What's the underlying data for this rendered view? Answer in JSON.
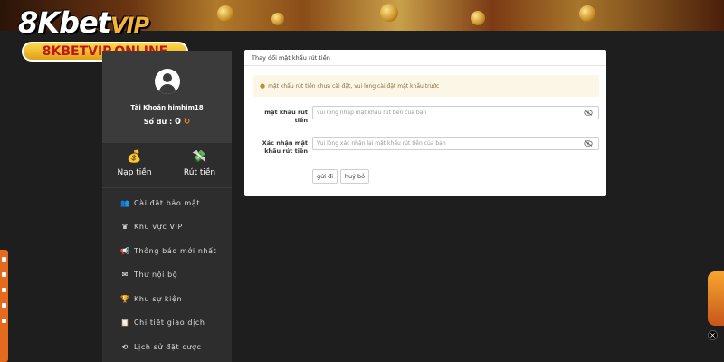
{
  "brand": {
    "logo_main": "8Kbet",
    "logo_vip": "VIP",
    "domain_pill": "8KBETVIP.ONLINE"
  },
  "profile": {
    "username": "Tài Khoản himhim18",
    "balance_label": "Số dư :",
    "balance_value": "0",
    "refresh_icon": "↻"
  },
  "actions": [
    {
      "label": "Nạp tiền",
      "icon": "deposit-icon",
      "glyph": "💰"
    },
    {
      "label": "Rút tiền",
      "icon": "withdraw-icon",
      "glyph": "💸"
    }
  ],
  "menu": [
    {
      "label": "Cài đặt bảo mật",
      "icon": "user-lock-icon",
      "glyph": "👥"
    },
    {
      "label": "Khu vực VIP",
      "icon": "crown-icon",
      "glyph": "♛"
    },
    {
      "label": "Thông báo mới nhất",
      "icon": "megaphone-icon",
      "glyph": "📢"
    },
    {
      "label": "Thư nội bộ",
      "icon": "envelope-icon",
      "glyph": "✉"
    },
    {
      "label": "Khu sự kiện",
      "icon": "trophy-icon",
      "glyph": "🏆"
    },
    {
      "label": "Chi tiết giao dịch",
      "icon": "clipboard-icon",
      "glyph": "📋"
    },
    {
      "label": "Lịch sử đặt cược",
      "icon": "history-icon",
      "glyph": "⟲"
    }
  ],
  "panel": {
    "title": "Thay đổi mật khẩu rút tiền",
    "alert_icon": "!",
    "alert_text": "mật khẩu rút tiền chưa cài đặt, vui lòng cài đặt mật khẩu trước",
    "field1_label": "mật khẩu rút tiền",
    "field1_placeholder": "vui lòng nhập mật khẩu rút tiền của bạn",
    "field2_label": "Xác nhận mật khẩu rút tiền",
    "field2_placeholder": "Vui lòng xác nhận lại mật khẩu rút tiền của bạn",
    "submit_label": "gửi đi",
    "cancel_label": "huỷ bỏ"
  },
  "overlay": {
    "close_label": "×"
  },
  "colors": {
    "accent_orange": "#f08a1c",
    "pill_red": "#c0171b",
    "sidebar_bg": "#2d2d2d"
  }
}
